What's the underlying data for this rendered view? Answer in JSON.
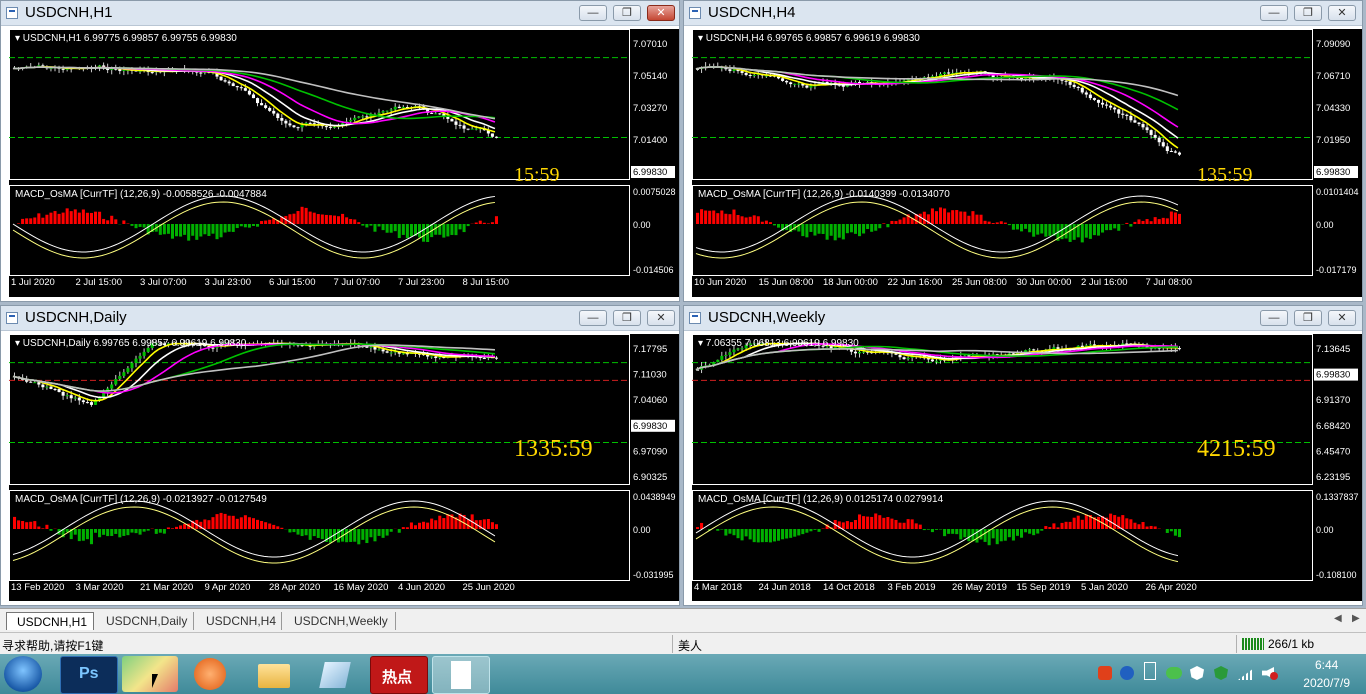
{
  "windows": [
    {
      "id": "h1",
      "title": "USDCNH,H1",
      "info": "USDCNH,H1  6.99775 6.99857 6.99755 6.99830",
      "price_scale": [
        "7.07010",
        "7.05140",
        "7.03270",
        "7.01400",
        "6.99830"
      ],
      "current_price": "6.99830",
      "timer": "15:59",
      "macd_label": "MACD_OsMA [CurrTF] (12,26,9) -0.0058526 -0.0047884",
      "macd_scale": [
        "0.0075028",
        "0.00",
        "-0.014506"
      ],
      "time_axis": [
        "1 Jul 2020",
        "2 Jul 15:00",
        "3 Jul 07:00",
        "3 Jul 23:00",
        "6 Jul 15:00",
        "7 Jul 07:00",
        "7 Jul 23:00",
        "8 Jul 15:00"
      ]
    },
    {
      "id": "h4",
      "title": "USDCNH,H4",
      "info": "USDCNH,H4  6.99765 6.99857 6.99619 6.99830",
      "price_scale": [
        "7.09090",
        "7.06710",
        "7.04330",
        "7.01950",
        "6.99830"
      ],
      "current_price": "6.99830",
      "timer": "135:59",
      "macd_label": "MACD_OsMA [CurrTF] (12,26,9) -0.0140399 -0.0134070",
      "macd_scale": [
        "0.0101404",
        "0.00",
        "-0.017179"
      ],
      "time_axis": [
        "10 Jun 2020",
        "15 Jun 08:00",
        "18 Jun 00:00",
        "22 Jun 16:00",
        "25 Jun 08:00",
        "30 Jun 00:00",
        "2 Jul 16:00",
        "7 Jul 08:00"
      ]
    },
    {
      "id": "daily",
      "title": "USDCNH,Daily",
      "info": "USDCNH,Daily  6.99765 6.99857 6.99619 6.99830",
      "price_scale": [
        "7.17795",
        "7.11030",
        "7.04060",
        "6.99830",
        "6.97090",
        "6.90325"
      ],
      "current_price": "6.99830",
      "timer": "1335:59",
      "macd_label": "MACD_OsMA [CurrTF] (12,26,9) -0.0213927 -0.0127549",
      "macd_scale": [
        "0.0438949",
        "0.00",
        "-0.031995"
      ],
      "time_axis": [
        "13 Feb 2020",
        "3 Mar 2020",
        "21 Mar 2020",
        "9 Apr 2020",
        "28 Apr 2020",
        "16 May 2020",
        "4 Jun 2020",
        "25 Jun 2020"
      ]
    },
    {
      "id": "weekly",
      "title": "USDCNH,Weekly",
      "info": "7.06355 7.06813 6.99619 6.99830",
      "price_scale": [
        "7.13645",
        "6.99830",
        "6.91370",
        "6.68420",
        "6.45470",
        "6.23195"
      ],
      "current_price": "6.99830",
      "timer": "4215:59",
      "macd_label": "MACD_OsMA [CurrTF] (12,26,9) 0.0125174 0.0279914",
      "macd_scale": [
        "0.1337837",
        "0.00",
        "-0.108100"
      ],
      "time_axis": [
        "4 Mar 2018",
        "24 Jun 2018",
        "14 Oct 2018",
        "3 Feb 2019",
        "26 May 2019",
        "15 Sep 2019",
        "5 Jan 2020",
        "26 Apr 2020"
      ]
    }
  ],
  "tabs": [
    "USDCNH,H1",
    "USDCNH,Daily",
    "USDCNH,H4",
    "USDCNH,Weekly"
  ],
  "status": {
    "help": "寻求帮助,请按F1键",
    "profile": "美人",
    "traffic": "266/1 kb"
  },
  "taskbar": {
    "apps": [
      "start-orb",
      "photoshop",
      "maps",
      "media",
      "explorer",
      "notepad",
      "hotspot",
      "document"
    ],
    "ps_label": "Ps",
    "hot_label": "热点",
    "time": "6:44",
    "date": "2020/7/9"
  },
  "colors": {
    "candle_up": "#00c000",
    "candle_down": "#ffffff",
    "ma_fast": "#ffff00",
    "ma_slow": "#ff00ff",
    "ma_mid": "#00c000",
    "ma_long": "#c0c0c0",
    "macd_pos": "#ff0000",
    "macd_neg": "#00b000",
    "timer": "#ffd700"
  }
}
